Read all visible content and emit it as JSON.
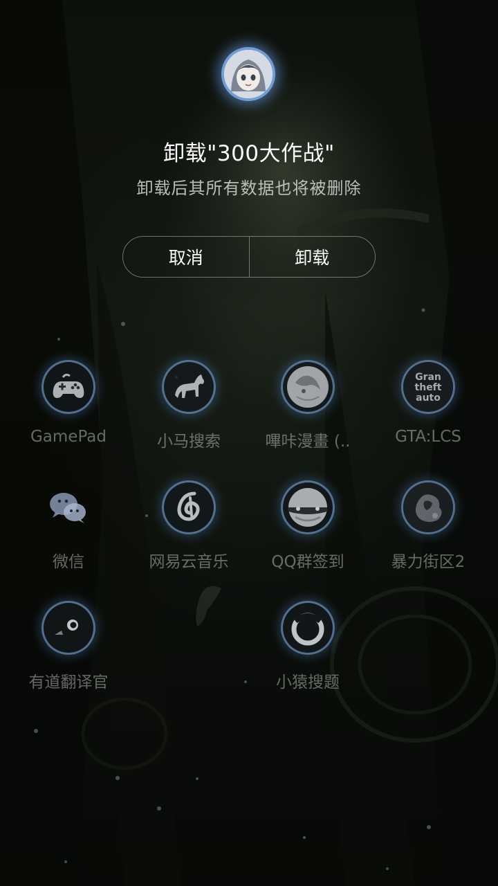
{
  "dialog": {
    "title": "卸载\"300大作战\"",
    "subtitle": "卸载后其所有数据也将被删除",
    "cancel_label": "取消",
    "confirm_label": "卸载"
  },
  "apps": [
    {
      "label": "GamePad",
      "icon": "gamepad-icon"
    },
    {
      "label": "小马搜索",
      "icon": "horse-icon"
    },
    {
      "label": "嗶咔漫畫 (..",
      "icon": "manga-icon"
    },
    {
      "label": "GTA:LCS",
      "icon": "gta-icon"
    },
    {
      "label": "微信",
      "icon": "wechat-icon"
    },
    {
      "label": "网易云音乐",
      "icon": "music-icon"
    },
    {
      "label": "QQ群签到",
      "icon": "qq-icon"
    },
    {
      "label": "暴力街区2",
      "icon": "game-icon"
    },
    {
      "label": "有道翻译官",
      "icon": "bird-icon"
    },
    {
      "label": "小猿搜题",
      "icon": "ring-icon"
    }
  ],
  "colors": {
    "ring": "#6f9fd6",
    "text": "#ffffff"
  }
}
